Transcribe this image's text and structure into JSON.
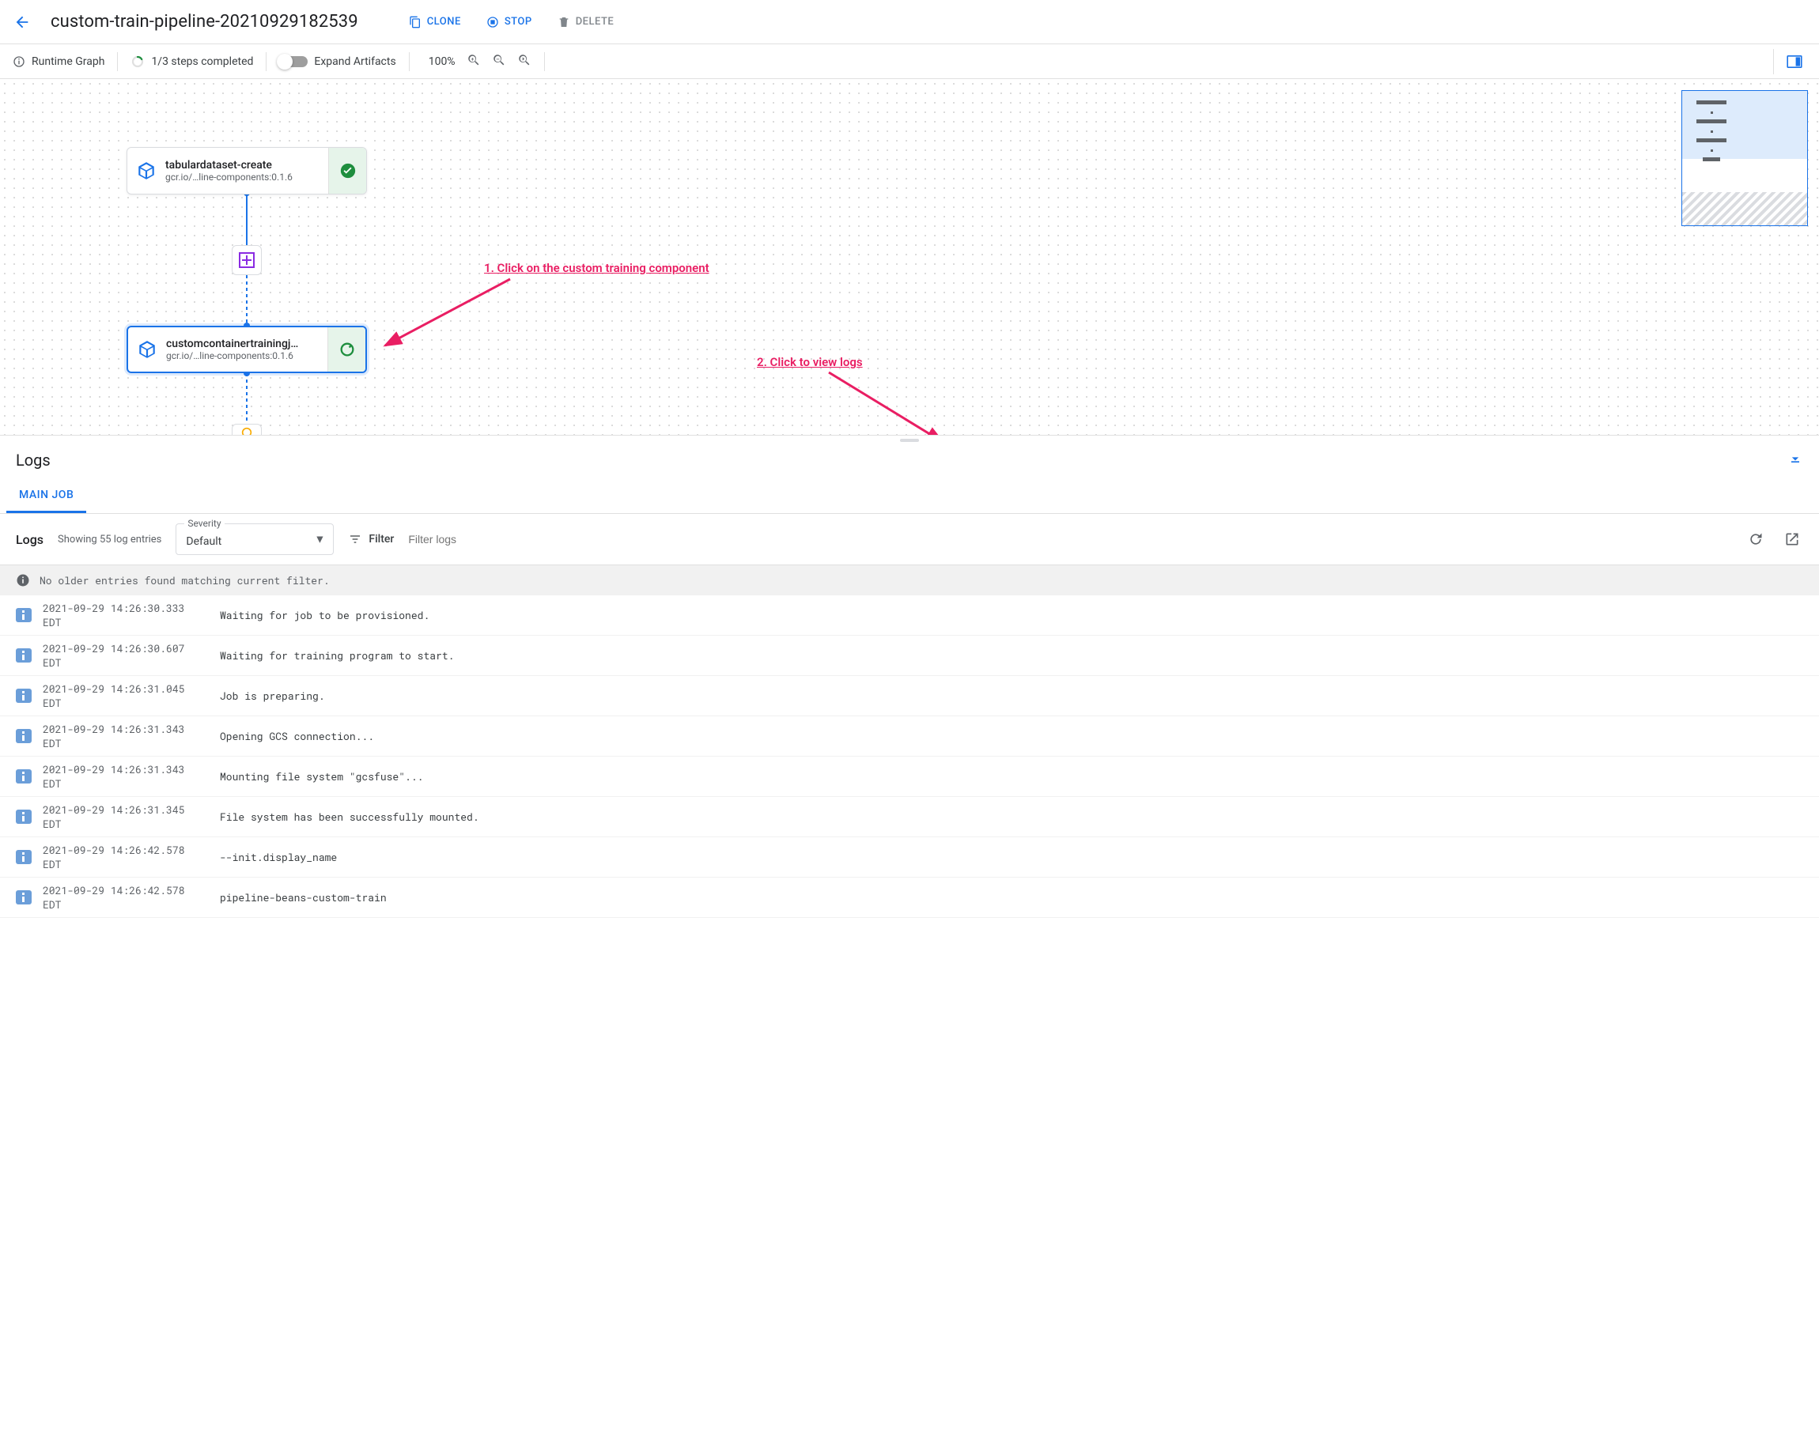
{
  "header": {
    "title": "custom-train-pipeline-20210929182539",
    "clone": "CLONE",
    "stop": "STOP",
    "delete": "DELETE"
  },
  "subheader": {
    "runtime_graph": "Runtime Graph",
    "steps": "1/3 steps completed",
    "expand_artifacts": "Expand Artifacts",
    "zoom": "100%"
  },
  "nodes": {
    "n1": {
      "title": "tabulardataset-create",
      "sub": "gcr.io/…line-components:0.1.6"
    },
    "n2": {
      "title": "customcontainertrainingj…",
      "sub": "gcr.io/…line-components:0.1.6"
    }
  },
  "annotations": {
    "a1": "1. Click on the custom training component",
    "a2": "2. Click to view logs"
  },
  "logs_panel": {
    "title": "Logs",
    "tab_main": "MAIN JOB",
    "label": "Logs",
    "showing": "Showing 55 log entries",
    "severity_label": "Severity",
    "severity_value": "Default",
    "filter_label": "Filter",
    "filter_placeholder": "Filter logs",
    "no_older": "No older entries found matching current filter."
  },
  "log_entries": [
    {
      "ts": "2021-09-29 14:26:30.333 EDT",
      "msg": "Waiting for job to be provisioned."
    },
    {
      "ts": "2021-09-29 14:26:30.607 EDT",
      "msg": "Waiting for training program to start."
    },
    {
      "ts": "2021-09-29 14:26:31.045 EDT",
      "msg": "Job is preparing."
    },
    {
      "ts": "2021-09-29 14:26:31.343 EDT",
      "msg": "Opening GCS connection..."
    },
    {
      "ts": "2021-09-29 14:26:31.343 EDT",
      "msg": "Mounting file system \"gcsfuse\"..."
    },
    {
      "ts": "2021-09-29 14:26:31.345 EDT",
      "msg": "File system has been successfully mounted."
    },
    {
      "ts": "2021-09-29 14:26:42.578 EDT",
      "msg": "--init.display_name"
    },
    {
      "ts": "2021-09-29 14:26:42.578 EDT",
      "msg": "pipeline-beans-custom-train"
    }
  ]
}
